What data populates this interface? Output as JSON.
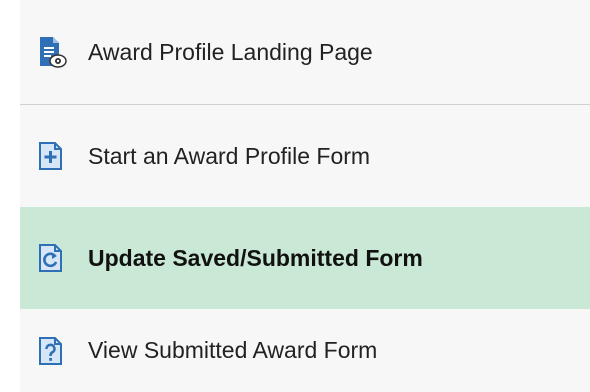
{
  "nav": {
    "items": [
      {
        "label": "Award Profile Landing Page",
        "icon": "document-view-icon",
        "active": false
      },
      {
        "label": "Start an Award Profile Form",
        "icon": "document-add-icon",
        "active": false
      },
      {
        "label": "Update Saved/Submitted Form",
        "icon": "document-refresh-icon",
        "active": true
      },
      {
        "label": "View Submitted Award Form",
        "icon": "document-question-icon",
        "active": false
      }
    ],
    "colors": {
      "active_background": "#c9e9d6",
      "item_background": "#f7f7f7",
      "icon_blue": "#2f6fb5"
    }
  }
}
